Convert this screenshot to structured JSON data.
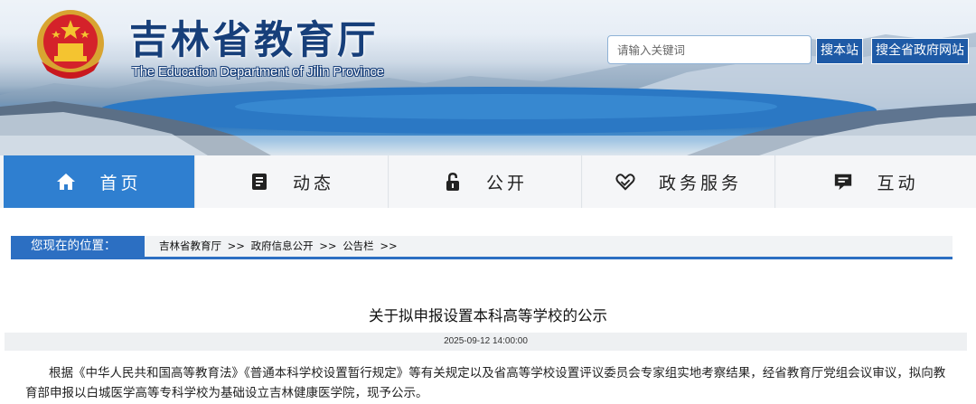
{
  "header": {
    "title": "吉林省教育厅",
    "subtitle": "The Education Department of Jilin Province",
    "search_placeholder": "请输入关键词",
    "search_this_site": "搜本站",
    "search_provincial_sites": "搜全省政府网站"
  },
  "nav": {
    "items": [
      {
        "label": "首页",
        "icon": "home-icon",
        "active": true
      },
      {
        "label": "动态",
        "icon": "document-icon",
        "active": false
      },
      {
        "label": "公开",
        "icon": "lock-icon",
        "active": false
      },
      {
        "label": "政务服务",
        "icon": "handshake-heart-icon",
        "active": false
      },
      {
        "label": "互动",
        "icon": "chat-icon",
        "active": false
      }
    ]
  },
  "breadcrumb": {
    "label": "您现在的位置：",
    "items": [
      "吉林省教育厅",
      ">>",
      "政府信息公开",
      ">>",
      "公告栏",
      ">>"
    ]
  },
  "article": {
    "title": "关于拟申报设置本科高等学校的公示",
    "date": "2025-09-12 14:00:00",
    "body": "根据《中华人民共和国高等教育法》《普通本科学校设置暂行规定》等有关规定以及省高等学校设置评议委员会专家组实地考察结果，经省教育厅党组会议审议，拟向教育部申报以白城医学高等专科学校为基础设立吉林健康医学院，现予公示。"
  },
  "colors": {
    "nav_active": "#2f7fd0",
    "breadcrumb_blue": "#2c6fc2",
    "search_button": "#1e5aa6",
    "title_blue": "#173f7a"
  }
}
